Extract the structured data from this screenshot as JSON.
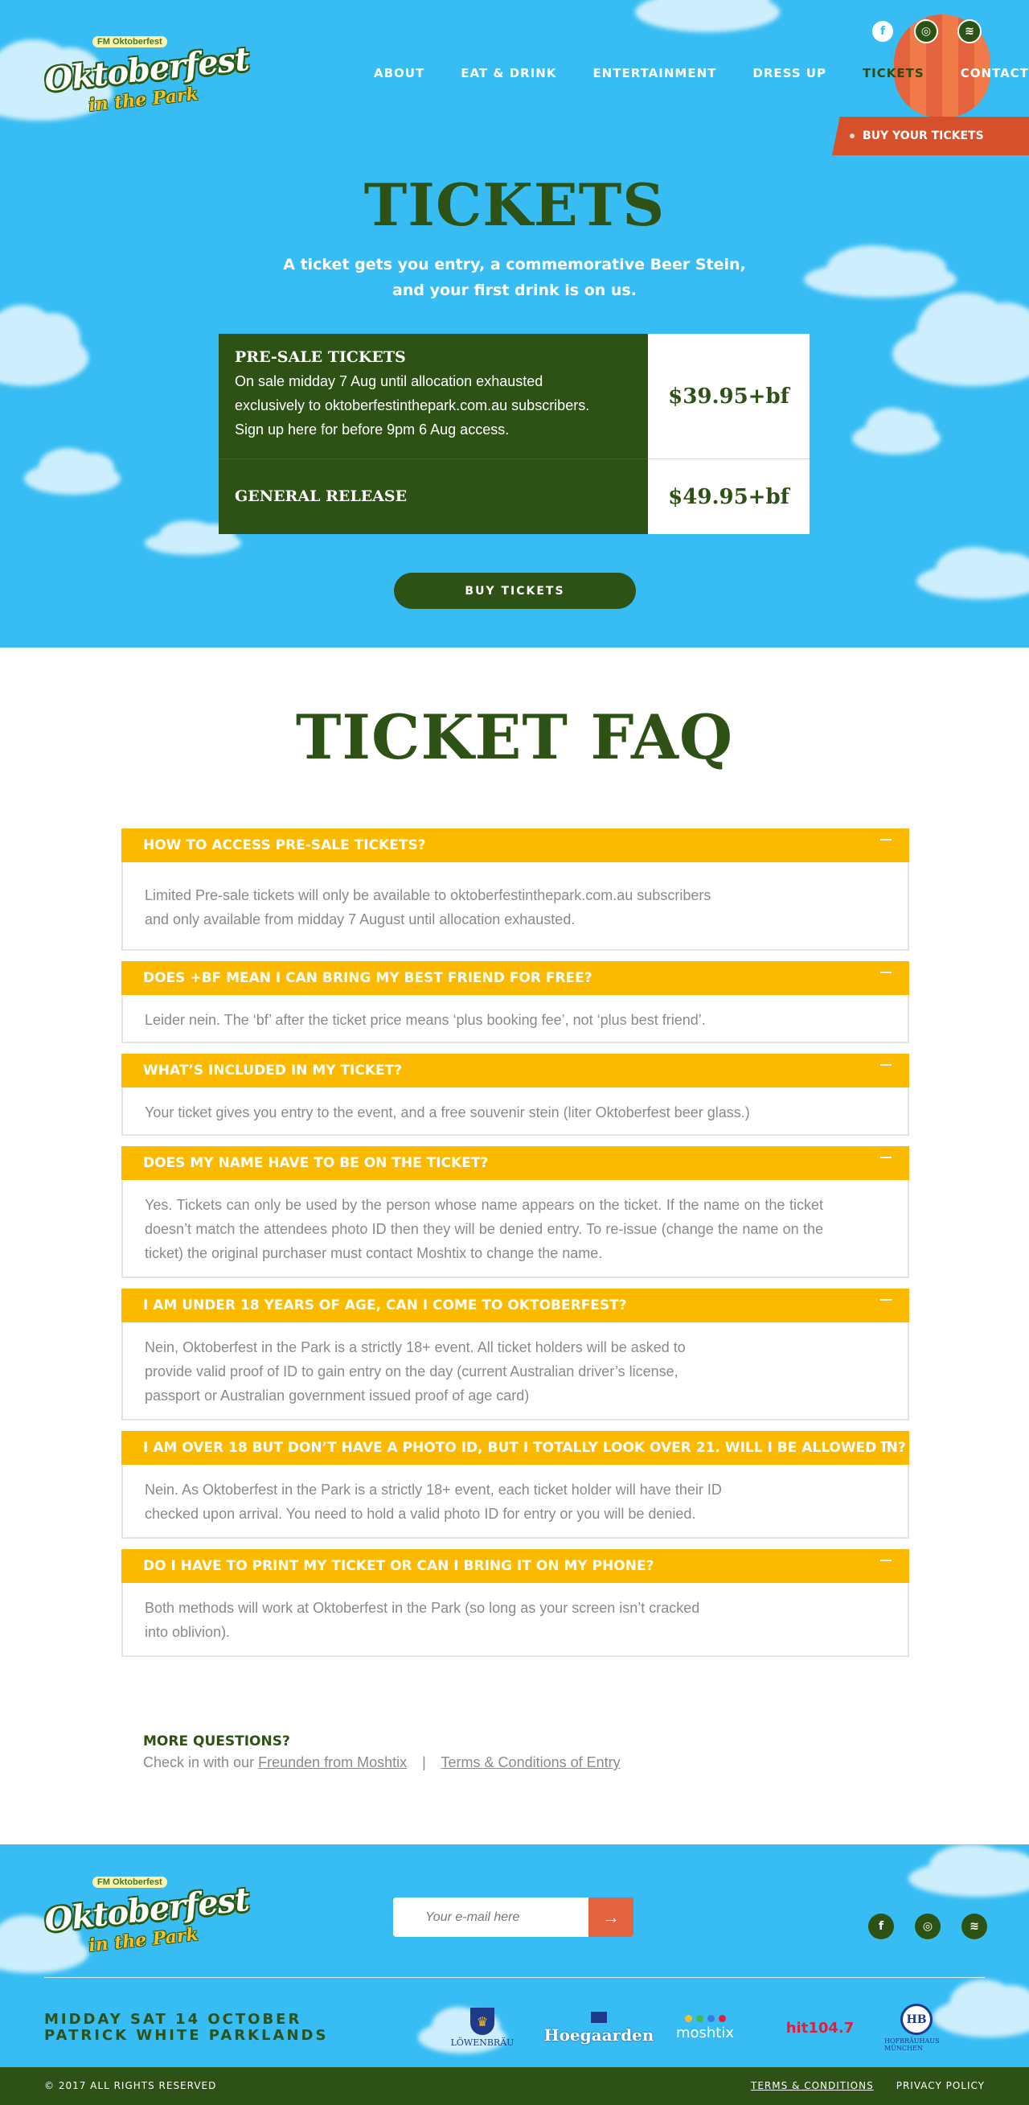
{
  "header": {
    "logo_badge": "FM Oktoberfest",
    "logo_main": "Oktoberfest",
    "logo_sub": "in the Park",
    "nav": [
      "ABOUT",
      "EAT & DRINK",
      "ENTERTAINMENT",
      "DRESS UP",
      "TICKETS",
      "CONTACT"
    ],
    "active_nav": "TICKETS",
    "social": [
      "facebook-icon",
      "instagram-icon",
      "spotify-icon"
    ],
    "buy_banner": "BUY YOUR TICKETS"
  },
  "hero": {
    "title": "TICKETS",
    "subtitle_line1": "A ticket gets you entry, a commemorative Beer Stein,",
    "subtitle_line2": "and your first drink is on us.",
    "tickets": [
      {
        "name": "PRE-SALE TICKETS",
        "desc_line1": "On sale midday 7 Aug until allocation exhausted",
        "desc_line2": "exclusively to oktoberfestinthepark.com.au subscribers.",
        "desc_line3": "Sign up here for before 9pm 6 Aug access.",
        "price": "$39.95+bf"
      },
      {
        "name": "GENERAL RELEASE",
        "price": "$49.95+bf"
      }
    ],
    "buy_button": "BUY TICKETS"
  },
  "faq": {
    "title": "TICKET FAQ",
    "items": [
      {
        "q": "HOW TO ACCESS PRE-SALE TICKETS?",
        "a1": "Limited Pre-sale tickets will only be available to oktoberfestinthepark.com.au subscribers",
        "a2": "and only available from midday 7 August until allocation exhausted."
      },
      {
        "q": "DOES +BF MEAN I CAN BRING MY BEST FRIEND FOR FREE?",
        "a1": "Leider nein. The ‘bf’ after the ticket price means ‘plus booking fee’, not ‘plus best friend’."
      },
      {
        "q": "WHAT’S INCLUDED IN MY TICKET?",
        "a1": "Your ticket gives you entry to the event, and a free souvenir stein (liter Oktoberfest beer glass.)"
      },
      {
        "q": "DOES MY NAME HAVE TO BE ON THE TICKET?",
        "a1": "Yes. Tickets can only be used by the person whose name appears on the ticket. If the name on the ticket doesn’t match the attendees photo ID then they will be denied entry. To re-issue (change the name on the ticket) the original purchaser must contact Moshtix to change the name."
      },
      {
        "q": "I AM UNDER 18 YEARS OF AGE, CAN I COME TO OKTOBERFEST?",
        "a1": "Nein, Oktoberfest in the Park is a strictly 18+ event. All ticket holders will be asked to",
        "a2": "provide valid proof of ID to gain entry on the day (current Australian driver’s license,",
        "a3": "passport or Australian government issued proof of age card)"
      },
      {
        "q": "I AM OVER 18 BUT DON’T HAVE A PHOTO ID, BUT I TOTALLY LOOK OVER 21. WILL I BE ALLOWED IN?",
        "a1": "Nein. As Oktoberfest in the Park is a strictly 18+ event, each ticket holder will have their ID",
        "a2": "checked upon arrival. You need to hold a valid photo ID for entry or you will be denied."
      },
      {
        "q": "DO I HAVE TO PRINT MY TICKET OR CAN I BRING IT ON MY PHONE?",
        "a1": "Both methods will work at Oktoberfest in the Park (so long as your screen isn’t cracked",
        "a2": "into oblivion)."
      }
    ],
    "more_title": "MORE QUESTIONS?",
    "more_prefix": "Check in with our",
    "more_link1": "Freunden from Moshtix",
    "more_sep": "|",
    "more_link2": "Terms & Conditions of Entry"
  },
  "footer": {
    "email_placeholder": "Your e-mail here",
    "submit_icon": "→",
    "date_line1": "MIDDAY SAT 14 OCTOBER",
    "date_line2": "PATRICK WHITE PARKLANDS",
    "sponsors": {
      "lowenbrau": "LÖWENBRÄU",
      "hoegaarden": "Hoegaarden",
      "moshtix": "moshtix",
      "hit": "hit104.7",
      "hb": "HOFBRÄUHAUS MÜNCHEN",
      "hb_crest": "HB"
    },
    "copyright": "© 2017 ALL RIGHTS RESERVED",
    "terms": "TERMS & CONDITIONS",
    "privacy": "PRIVACY POLICY"
  }
}
